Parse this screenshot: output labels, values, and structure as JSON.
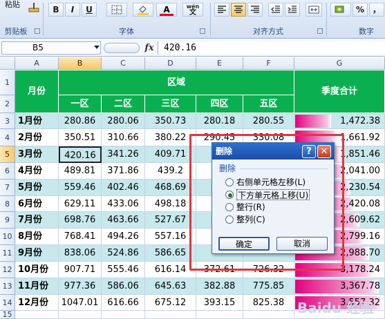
{
  "ribbon": {
    "clipboard_label": "剪贴板",
    "paste_label": "粘贴",
    "font_group_label": "字体",
    "align_group_label": "对齐方式",
    "number_group_label": "数字",
    "bold": "B",
    "italic": "I",
    "underline": "U",
    "font_color": "A",
    "wen": "wén",
    "wen_char": "文",
    "percent": "%",
    "comma": "，"
  },
  "formula_bar": {
    "name_box": "B5",
    "fx": "fx",
    "value": "420.16"
  },
  "columns": [
    "A",
    "B",
    "C",
    "D",
    "E",
    "F",
    "G"
  ],
  "rows": [
    "1",
    "2",
    "3",
    "4",
    "5",
    "6",
    "7",
    "8",
    "9",
    "10",
    "11",
    "12",
    "13",
    "14",
    "15"
  ],
  "sheet": {
    "month_header": "月份",
    "region_header": "区域",
    "total_header": "季度合计",
    "regions": [
      "一区",
      "二区",
      "三区",
      "四区",
      "五区"
    ],
    "data": [
      {
        "month": "1月份",
        "v": [
          "280.86",
          "280.06",
          "350.73",
          "280.18",
          "280.55"
        ],
        "total": "1,472.38"
      },
      {
        "month": "2月份",
        "v": [
          "350.51",
          "310.66",
          "380.22",
          "290.45",
          "330.08"
        ],
        "total": "1,661.92"
      },
      {
        "month": "3月份",
        "v": [
          "420.16",
          "341.26",
          "409.71",
          "",
          ""
        ],
        "total": "1,851.46"
      },
      {
        "month": "4月份",
        "v": [
          "489.81",
          "371.86",
          "439.2",
          "",
          ""
        ],
        "total": "2,041.00"
      },
      {
        "month": "5月份",
        "v": [
          "559.46",
          "402.46",
          "468.69",
          "",
          ""
        ],
        "total": "2,230.54"
      },
      {
        "month": "6月份",
        "v": [
          "629.11",
          "433.06",
          "498.18",
          "",
          ""
        ],
        "total": "2,420.08"
      },
      {
        "month": "7月份",
        "v": [
          "698.76",
          "463.66",
          "527.67",
          "",
          ""
        ],
        "total": "2,609.62"
      },
      {
        "month": "8月份",
        "v": [
          "768.41",
          "494.26",
          "557.16",
          "",
          ""
        ],
        "total": "2,799.16"
      },
      {
        "month": "9月份",
        "v": [
          "838.06",
          "524.86",
          "586.65",
          "",
          ""
        ],
        "total": "2,988.70"
      },
      {
        "month": "10月份",
        "v": [
          "907.71",
          "555.46",
          "616.14",
          "372.61",
          "726.32"
        ],
        "total": "3,178.24"
      },
      {
        "month": "11月份",
        "v": [
          "977.36",
          "586.06",
          "645.63",
          "382.88",
          "775.85"
        ],
        "total": "3,367.78"
      },
      {
        "month": "12月份",
        "v": [
          "1047.01",
          "616.66",
          "675.12",
          "393.15",
          "825.38"
        ],
        "total": "3,557.32"
      }
    ],
    "bar_fractions": [
      0.41,
      0.47,
      0.52,
      0.57,
      0.63,
      0.68,
      0.73,
      0.79,
      0.84,
      0.89,
      0.95,
      1.0
    ]
  },
  "dialog": {
    "title": "删除",
    "help": "?",
    "close": "✕",
    "group_label": "删除",
    "options": [
      {
        "label": "右侧单元格左移(L)",
        "selected": false
      },
      {
        "label": "下方单元格上移(U)",
        "selected": true
      },
      {
        "label": "整行(R)",
        "selected": false
      },
      {
        "label": "整列(C)",
        "selected": false
      }
    ],
    "ok": "确定",
    "cancel": "取消"
  },
  "watermark": "Baidu 经验",
  "colors": {
    "header_green": "#0ab050",
    "row_teal": "#c7e8ec",
    "bar_magenta": "#e3007e",
    "highlight_red": "#e0363f",
    "dialog_blue": "#1a4ea8"
  }
}
